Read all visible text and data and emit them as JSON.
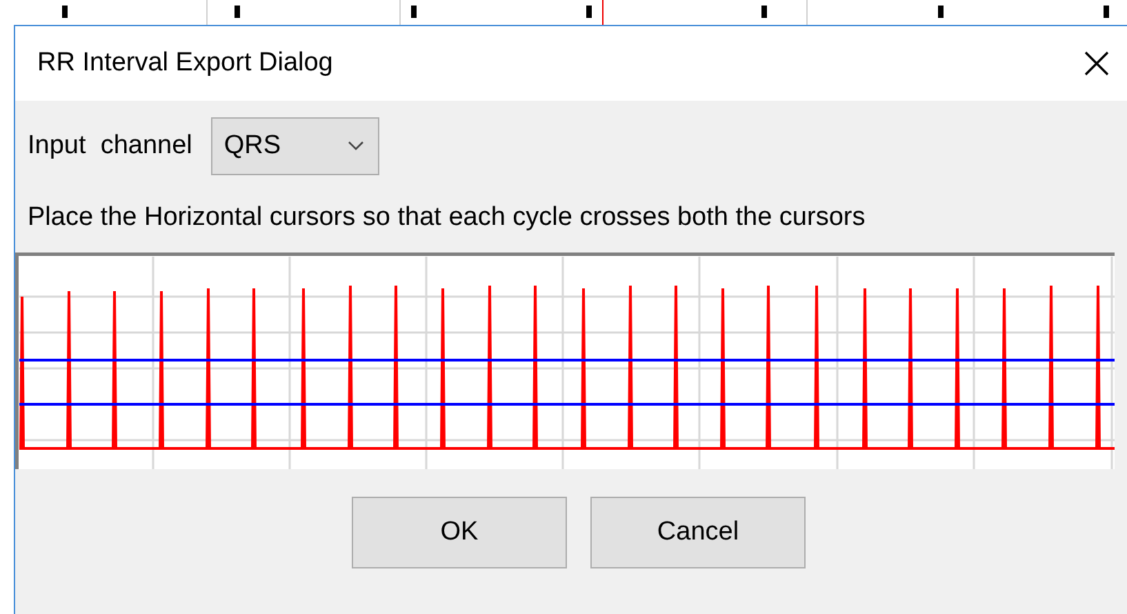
{
  "window": {
    "title": "RR Interval Export Dialog"
  },
  "input_channel": {
    "label": "Input  channel",
    "value": "QRS"
  },
  "instruction": "Place the Horizontal cursors so that each cycle crosses both the cursors",
  "buttons": [
    "OK",
    "Cancel"
  ]
}
